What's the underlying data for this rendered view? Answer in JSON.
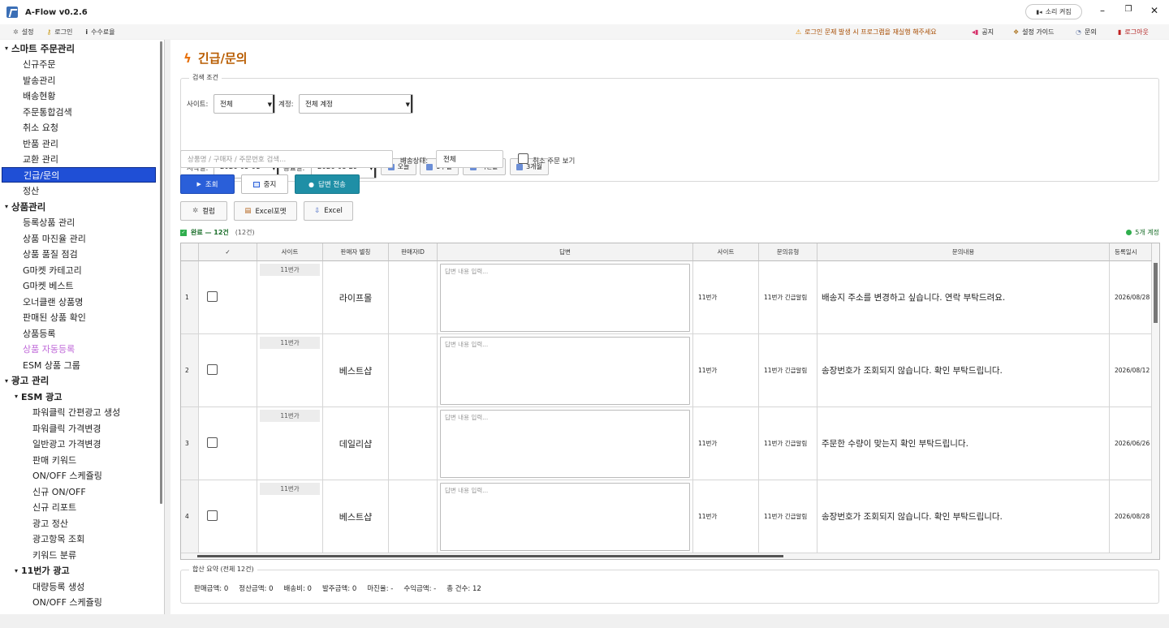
{
  "app": {
    "title": "A-Flow v0.2.6",
    "sound_toggle": "소리 켜짐"
  },
  "menubar": {
    "left": [
      {
        "icon": "gear-icon",
        "label": "설정"
      },
      {
        "icon": "key-icon",
        "label": "로그인"
      },
      {
        "icon": "info-icon",
        "label": "수수료율"
      }
    ],
    "notice": "로그인 문제 발생 시 프로그램을 재실행 해주세요",
    "right": [
      {
        "icon": "megaphone-icon",
        "label": "공지"
      },
      {
        "icon": "guide-icon",
        "label": "설정 가이드"
      },
      {
        "icon": "chat-icon",
        "label": "문의"
      },
      {
        "icon": "logout-icon",
        "label": "로그아웃"
      }
    ]
  },
  "sidebar": {
    "items": [
      {
        "label": "스마트 주문관리",
        "level": 0,
        "caret": "▾"
      },
      {
        "label": "신규주문",
        "level": 1
      },
      {
        "label": "발송관리",
        "level": 1
      },
      {
        "label": "배송현황",
        "level": 1
      },
      {
        "label": "주문통합검색",
        "level": 1
      },
      {
        "label": "취소 요청",
        "level": 1
      },
      {
        "label": "반품 관리",
        "level": 1
      },
      {
        "label": "교환 관리",
        "level": 1
      },
      {
        "label": "긴급/문의",
        "level": 1,
        "active": true
      },
      {
        "label": "정산",
        "level": 1
      },
      {
        "label": "상품관리",
        "level": 0,
        "caret": "▾"
      },
      {
        "label": "등록상품 관리",
        "level": 1
      },
      {
        "label": "상품 마진율 관리",
        "level": 1
      },
      {
        "label": "상품 품질 점검",
        "level": 1
      },
      {
        "label": "G마켓 카테고리",
        "level": 1
      },
      {
        "label": "G마켓 베스트",
        "level": 1
      },
      {
        "label": "오너클랜 상품명",
        "level": 1
      },
      {
        "label": "판매된 상품 확인",
        "level": 1
      },
      {
        "label": "상품등록",
        "level": 1
      },
      {
        "label": "상품 자동등록",
        "level": 1,
        "purple": true
      },
      {
        "label": "ESM 상품 그룹",
        "level": 1
      },
      {
        "label": "광고 관리",
        "level": 0,
        "caret": "▾"
      },
      {
        "label": "ESM 광고",
        "level": 1,
        "bold": true,
        "caret": "▾"
      },
      {
        "label": "파워클릭 간편광고 생성",
        "level": 2
      },
      {
        "label": "파워클릭 가격변경",
        "level": 2
      },
      {
        "label": "일반광고 가격변경",
        "level": 2
      },
      {
        "label": "판매 키워드",
        "level": 2
      },
      {
        "label": "ON/OFF 스케쥴링",
        "level": 2
      },
      {
        "label": "신규 ON/OFF",
        "level": 2
      },
      {
        "label": "신규 리포트",
        "level": 2
      },
      {
        "label": "광고 정산",
        "level": 2
      },
      {
        "label": "광고항목 조회",
        "level": 2
      },
      {
        "label": "키워드 분류",
        "level": 2
      },
      {
        "label": "11번가 광고",
        "level": 1,
        "bold": true,
        "caret": "▾"
      },
      {
        "label": "대량등록 생성",
        "level": 2
      },
      {
        "label": "ON/OFF 스케쥴링",
        "level": 2
      }
    ]
  },
  "page": {
    "title": "긴급/문의"
  },
  "search": {
    "legend": "검색 조건",
    "site_label": "사이트:",
    "site_value": "전체",
    "account_label": "계정:",
    "account_value": "전체 계정",
    "start_label": "시작일:",
    "start_value": "2026-05-01",
    "end_label": "종료일:",
    "end_value": "2026-08-29",
    "quick": [
      "오늘",
      "1주일",
      "이번달",
      "3개월"
    ],
    "keyword_placeholder": "상품명 / 구매자 / 주문번호 검색...",
    "delivery_label": "배송상태:",
    "delivery_value": "전체",
    "cancel_label": "취소 주문 보기"
  },
  "actions": {
    "query": "조회",
    "stop": "중지",
    "send": "답변 전송",
    "columns": "컬럼",
    "excel_format": "Excel포멧",
    "excel": "Excel"
  },
  "status": {
    "done": "완료 — 12건",
    "count": "(12건)",
    "accounts": "5개 계정"
  },
  "table": {
    "headers": [
      "",
      "✓",
      "사이트",
      "판매자 별칭",
      "판매자ID",
      "답변",
      "사이트",
      "문의유형",
      "문의내용",
      "등록일시"
    ],
    "answer_placeholder": "답변 내용 입력...",
    "rows": [
      {
        "no": "1",
        "site": "11번가",
        "alias": "라이프몰",
        "site2": "11번가",
        "type": "11번가 긴급알림",
        "content": "배송지 주소를 변경하고 싶습니다. 연락 부탁드려요.",
        "date": "2026/08/28"
      },
      {
        "no": "2",
        "site": "11번가",
        "alias": "베스트샵",
        "site2": "11번가",
        "type": "11번가 긴급알림",
        "content": "송장번호가 조회되지 않습니다. 확인 부탁드립니다.",
        "date": "2026/08/12"
      },
      {
        "no": "3",
        "site": "11번가",
        "alias": "데일리샵",
        "site2": "11번가",
        "type": "11번가 긴급알림",
        "content": "주문한 수량이 맞는지 확인 부탁드립니다.",
        "date": "2026/06/26"
      },
      {
        "no": "4",
        "site": "11번가",
        "alias": "베스트샵",
        "site2": "11번가",
        "type": "11번가 긴급알림",
        "content": "송장번호가 조회되지 않습니다. 확인 부탁드립니다.",
        "date": "2026/08/28"
      }
    ]
  },
  "summary": {
    "legend": "합산 요약 (전체 12건)",
    "items": [
      "판매금액: 0",
      "정산금액: 0",
      "배송비: 0",
      "발주금액: 0",
      "마진율: -",
      "수익금액: -",
      "총 건수: 12"
    ]
  }
}
